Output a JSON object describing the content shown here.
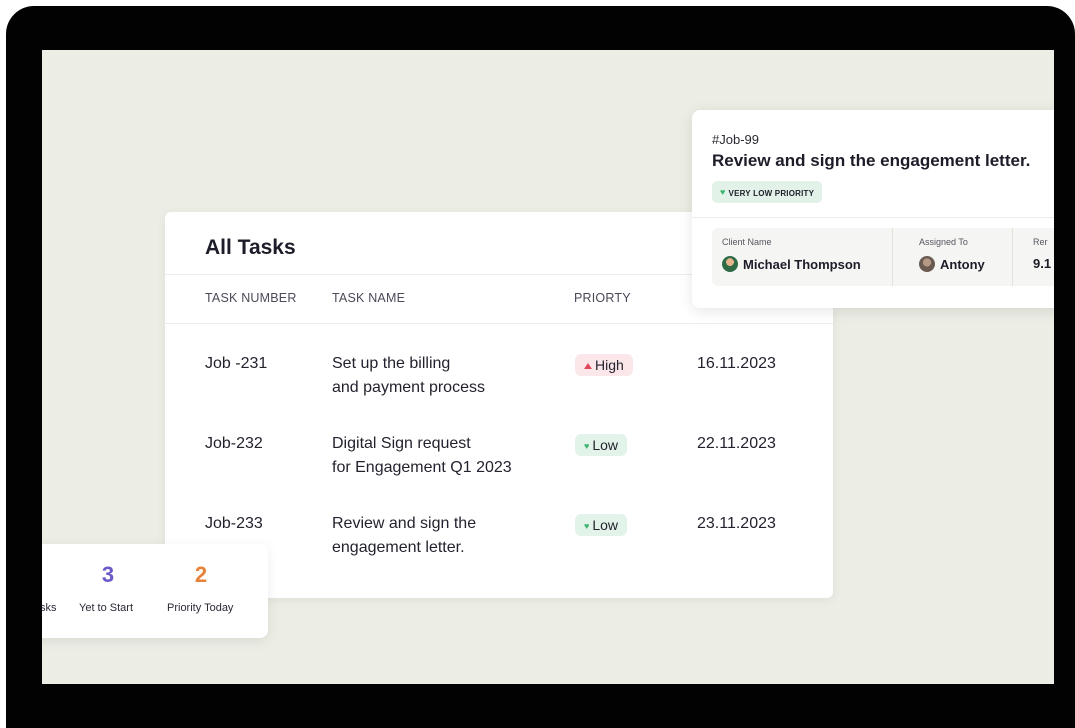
{
  "tasks": {
    "title": "All Tasks",
    "columns": [
      "TASK NUMBER",
      "TASK NAME",
      "PRIORTY"
    ],
    "rows": [
      {
        "number": "Job -231",
        "name_line1": "Set up the billing",
        "name_line2": "and payment process",
        "priority": "High",
        "date": "16.11.2023"
      },
      {
        "number": "Job-232",
        "name_line1": "Digital Sign request",
        "name_line2": "for Engagement Q1 2023",
        "priority": "Low",
        "date": "22.11.2023"
      },
      {
        "number": "Job-233",
        "name_line1": "Review and sign the",
        "name_line2": "engagement letter.",
        "priority": "Low",
        "date": "23.11.2023"
      }
    ]
  },
  "job_card": {
    "number": "#Job-99",
    "title": "Review and sign the engagement letter.",
    "priority_label": "VERY LOW PRIORITY",
    "fields": {
      "client_label": "Client Name",
      "client_value": "Michael Thompson",
      "assigned_label": "Assigned To",
      "assigned_value": "Antony",
      "third_label": "Rer",
      "third_value": "9.1"
    }
  },
  "stats": [
    {
      "value": "",
      "label": "sks"
    },
    {
      "value": "3",
      "label": "Yet to Start"
    },
    {
      "value": "2",
      "label": "Priority Today"
    }
  ],
  "colors": {
    "background": "#ecede5",
    "bezel": "#020202",
    "high_pill": "#fbe7ea",
    "low_pill": "#e2f3ea",
    "high_icon": "#e0485e",
    "low_icon": "#39b56e",
    "yet_to_start": "#6c58c8",
    "priority_today": "#e8813a"
  },
  "icons": {
    "high_priority": "triangle-up-icon",
    "low_priority": "heart-icon",
    "client_avatar": "avatar-michael",
    "assignee_avatar": "avatar-antony"
  }
}
